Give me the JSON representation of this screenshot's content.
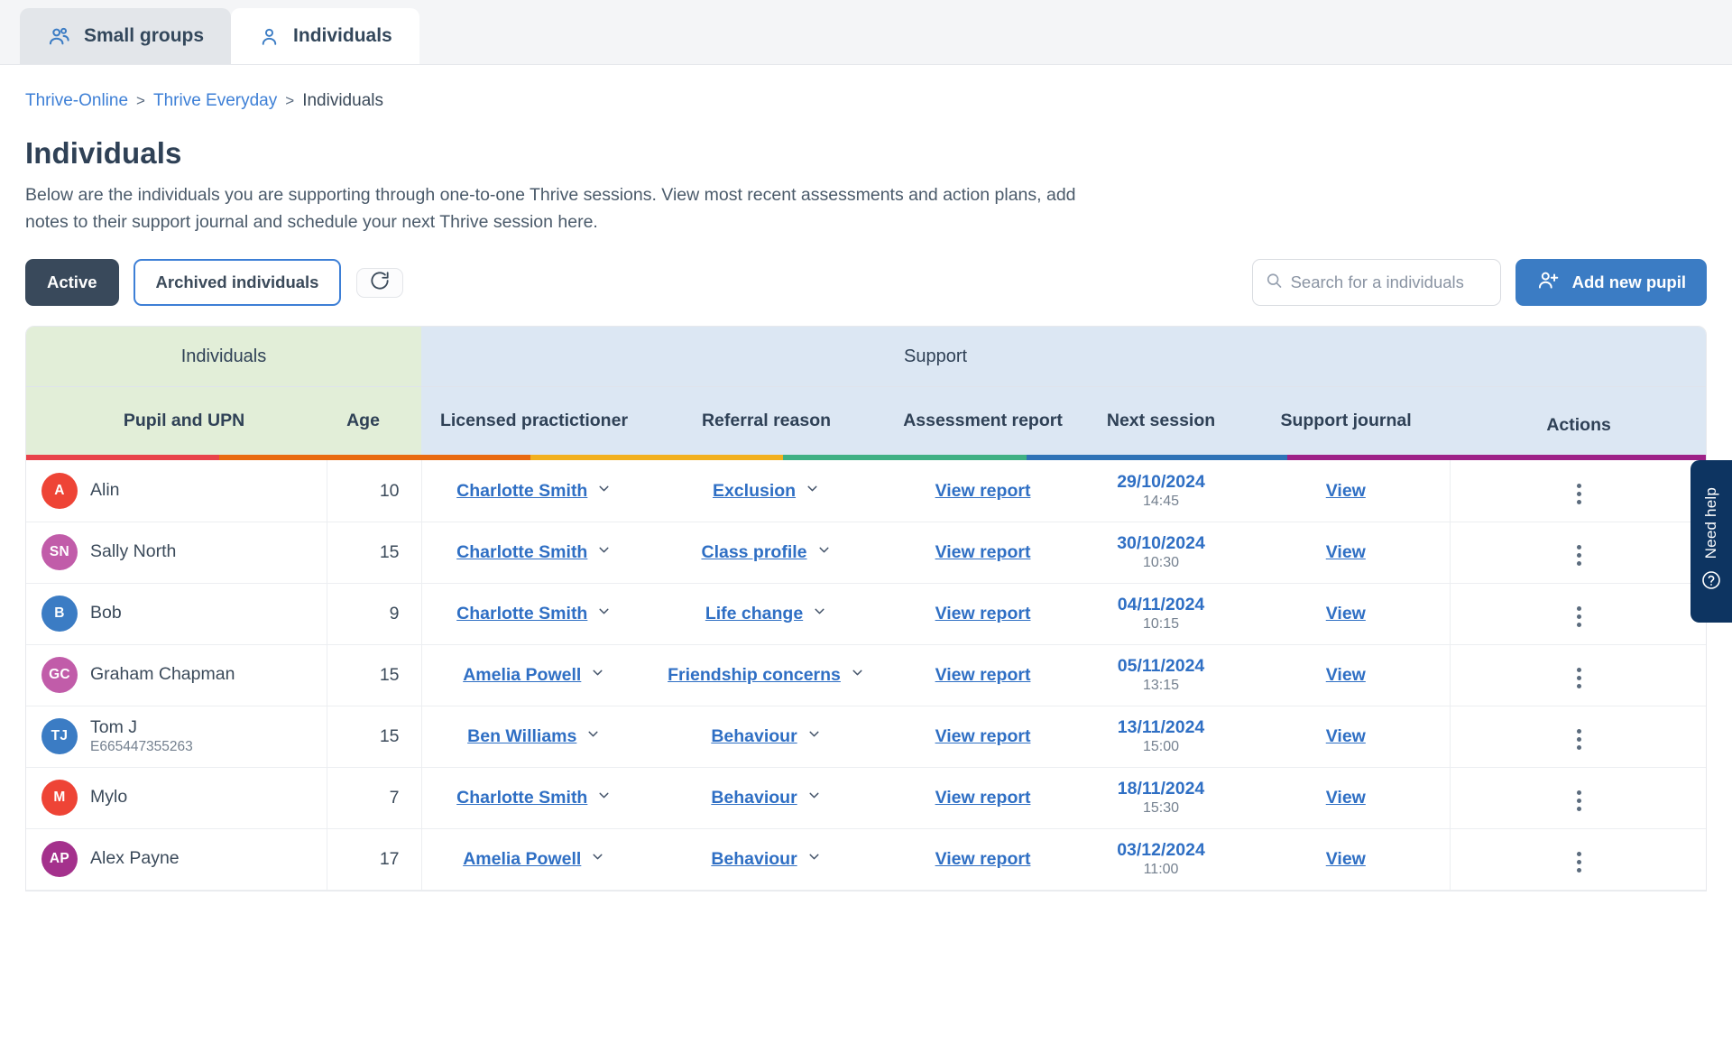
{
  "tabs": [
    {
      "label": "Small groups",
      "icon": "users-group-icon",
      "active": false
    },
    {
      "label": "Individuals",
      "icon": "user-icon",
      "active": true
    }
  ],
  "breadcrumb": {
    "items": [
      "Thrive-Online",
      "Thrive Everyday",
      "Individuals"
    ],
    "separator": ">"
  },
  "header": {
    "title": "Individuals",
    "description": "Below are the individuals you are supporting through one-to-one Thrive sessions. View most recent assessments and action plans, add notes to their support journal and schedule your next Thrive session here."
  },
  "controls": {
    "active_label": "Active",
    "archived_label": "Archived individuals",
    "refresh_icon": "refresh-icon",
    "search_placeholder": "Search for a individuals",
    "search_value": "",
    "search_icon": "search-icon",
    "add_label": "Add new pupil",
    "add_icon": "user-plus-icon"
  },
  "table": {
    "groups": [
      {
        "label": "Individuals",
        "span": 2,
        "bg": "#e2eed8"
      },
      {
        "label": "Support",
        "span": 5,
        "bg": "#dce7f3"
      },
      {
        "label": "",
        "span": 1,
        "bg": "#dce7f3"
      }
    ],
    "columns": [
      "Pupil and UPN",
      "Age",
      "Licensed practictioner",
      "Referral reason",
      "Assessment report",
      "Next session",
      "Support journal",
      "Actions"
    ],
    "rainbow": [
      {
        "color": "#e8424a",
        "width": 11.5
      },
      {
        "color": "#e96a10",
        "width": 18.5
      },
      {
        "color": "#f2b01e",
        "width": 15
      },
      {
        "color": "#3fb083",
        "width": 14.5
      },
      {
        "color": "#2f73b6",
        "width": 15.5
      },
      {
        "color": "#9e2187",
        "width": 25
      }
    ],
    "rows": [
      {
        "initials": "A",
        "avatar_color": "#ee4436",
        "name": "Alin",
        "upn": "",
        "age": "10",
        "practitioner": "Charlotte Smith",
        "referral": "Exclusion",
        "report": "View report",
        "session_date": "29/10/2024",
        "session_time": "14:45",
        "journal": "View"
      },
      {
        "initials": "SN",
        "avatar_color": "#c15ca9",
        "name": "Sally North",
        "upn": "",
        "age": "15",
        "practitioner": "Charlotte Smith",
        "referral": "Class profile",
        "report": "View report",
        "session_date": "30/10/2024",
        "session_time": "10:30",
        "journal": "View"
      },
      {
        "initials": "B",
        "avatar_color": "#3b7cc4",
        "name": "Bob",
        "upn": "",
        "age": "9",
        "practitioner": "Charlotte Smith",
        "referral": "Life change",
        "report": "View report",
        "session_date": "04/11/2024",
        "session_time": "10:15",
        "journal": "View"
      },
      {
        "initials": "GC",
        "avatar_color": "#c15ca9",
        "name": "Graham Chapman",
        "upn": "",
        "age": "15",
        "practitioner": "Amelia Powell",
        "referral": "Friendship concerns",
        "report": "View report",
        "session_date": "05/11/2024",
        "session_time": "13:15",
        "journal": "View"
      },
      {
        "initials": "TJ",
        "avatar_color": "#3b7cc4",
        "name": "Tom J",
        "upn": "E665447355263",
        "age": "15",
        "practitioner": "Ben Williams",
        "referral": "Behaviour",
        "report": "View report",
        "session_date": "13/11/2024",
        "session_time": "15:00",
        "journal": "View"
      },
      {
        "initials": "M",
        "avatar_color": "#ee4436",
        "name": "Mylo",
        "upn": "",
        "age": "7",
        "practitioner": "Charlotte Smith",
        "referral": "Behaviour",
        "report": "View report",
        "session_date": "18/11/2024",
        "session_time": "15:30",
        "journal": "View"
      },
      {
        "initials": "AP",
        "avatar_color": "#a4318c",
        "name": "Alex Payne",
        "upn": "",
        "age": "17",
        "practitioner": "Amelia Powell",
        "referral": "Behaviour",
        "report": "View report",
        "session_date": "03/12/2024",
        "session_time": "11:00",
        "journal": "View"
      }
    ]
  },
  "need_help": {
    "label": "Need help",
    "icon": "question-circle-icon"
  },
  "colors": {
    "accent_blue": "#3b7cc4",
    "link_blue": "#2f6fc4",
    "dark_navy": "#39495b",
    "header_green": "#e2eed8",
    "header_blue": "#dce7f3",
    "help_navy": "#0d3461"
  }
}
